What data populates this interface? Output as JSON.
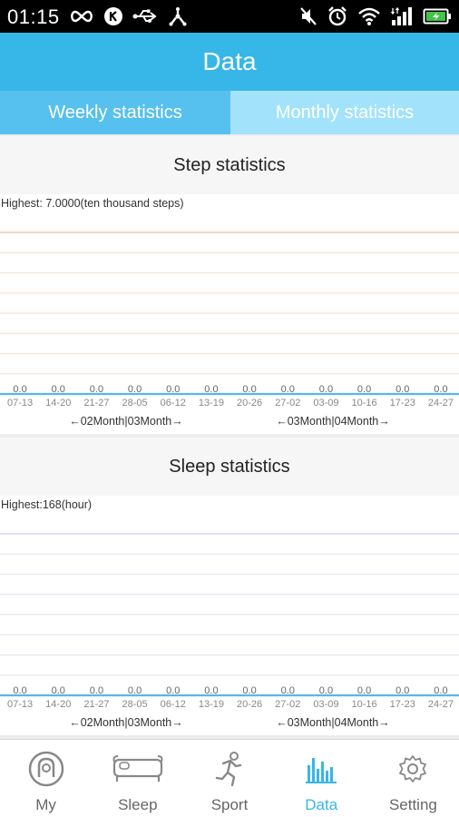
{
  "status_bar": {
    "time": "01:15",
    "left_icons": [
      "infinity-icon",
      "k-circle-icon",
      "usb-icon",
      "tether-icon"
    ],
    "right_icons": [
      "mute-icon",
      "alarm-icon",
      "wifi-icon",
      "signal-icon",
      "battery-charging-icon"
    ]
  },
  "header": {
    "title": "Data"
  },
  "tabs": [
    {
      "label": "Weekly statistics",
      "active": true
    },
    {
      "label": "Monthly statistics",
      "active": false
    }
  ],
  "colors": {
    "accent": "#37b6e8",
    "tab_active": "#56c0ee",
    "tab_inactive": "#a3e2fb",
    "step_highlight_line": "#f6c7a7",
    "step_grid": "#f7e4d8",
    "sleep_highlight_line": "#d6d6f7",
    "sleep_grid": "#e7e7f2",
    "baseline": "#54b9e6"
  },
  "step_card": {
    "title": "Step statistics"
  },
  "sleep_card": {
    "title": "Sleep statistics"
  },
  "chart_data": [
    {
      "type": "bar",
      "title": "Step statistics",
      "highest_label": "Highest:  7.0000(ten thousand steps)",
      "categories": [
        "07-13",
        "14-20",
        "21-27",
        "28-05",
        "06-12",
        "13-19",
        "20-26",
        "27-02",
        "03-09",
        "10-16",
        "17-23",
        "24-27"
      ],
      "value_labels": [
        "0.0",
        "0.0",
        "0.0",
        "0.0",
        "0.0",
        "0.0",
        "0.0",
        "0.0",
        "0.0",
        "0.0",
        "0.0",
        "0.0"
      ],
      "values": [
        0,
        0,
        0,
        0,
        0,
        0,
        0,
        0,
        0,
        0,
        0,
        0
      ],
      "ylim": [
        0,
        7
      ],
      "grid": true,
      "month_labels": [
        "←02Month|03Month→",
        "←03Month|04Month→"
      ]
    },
    {
      "type": "bar",
      "title": "Sleep statistics",
      "highest_label": "Highest:168(hour)",
      "categories": [
        "07-13",
        "14-20",
        "21-27",
        "28-05",
        "06-12",
        "13-19",
        "20-26",
        "27-02",
        "03-09",
        "10-16",
        "17-23",
        "24-27"
      ],
      "value_labels": [
        "0.0",
        "0.0",
        "0.0",
        "0.0",
        "0.0",
        "0.0",
        "0.0",
        "0.0",
        "0.0",
        "0.0",
        "0.0",
        "0.0"
      ],
      "values": [
        0,
        0,
        0,
        0,
        0,
        0,
        0,
        0,
        0,
        0,
        0,
        0
      ],
      "ylim": [
        0,
        168
      ],
      "grid": true,
      "month_labels": [
        "←02Month|03Month→",
        "←03Month|04Month→"
      ]
    }
  ],
  "bottom_nav": [
    {
      "label": "My",
      "icon": "profile-icon",
      "active": false
    },
    {
      "label": "Sleep",
      "icon": "bed-icon",
      "active": false
    },
    {
      "label": "Sport",
      "icon": "running-person-icon",
      "active": false
    },
    {
      "label": "Data",
      "icon": "bar-chart-icon",
      "active": true
    },
    {
      "label": "Setting",
      "icon": "gear-icon",
      "active": false
    }
  ]
}
